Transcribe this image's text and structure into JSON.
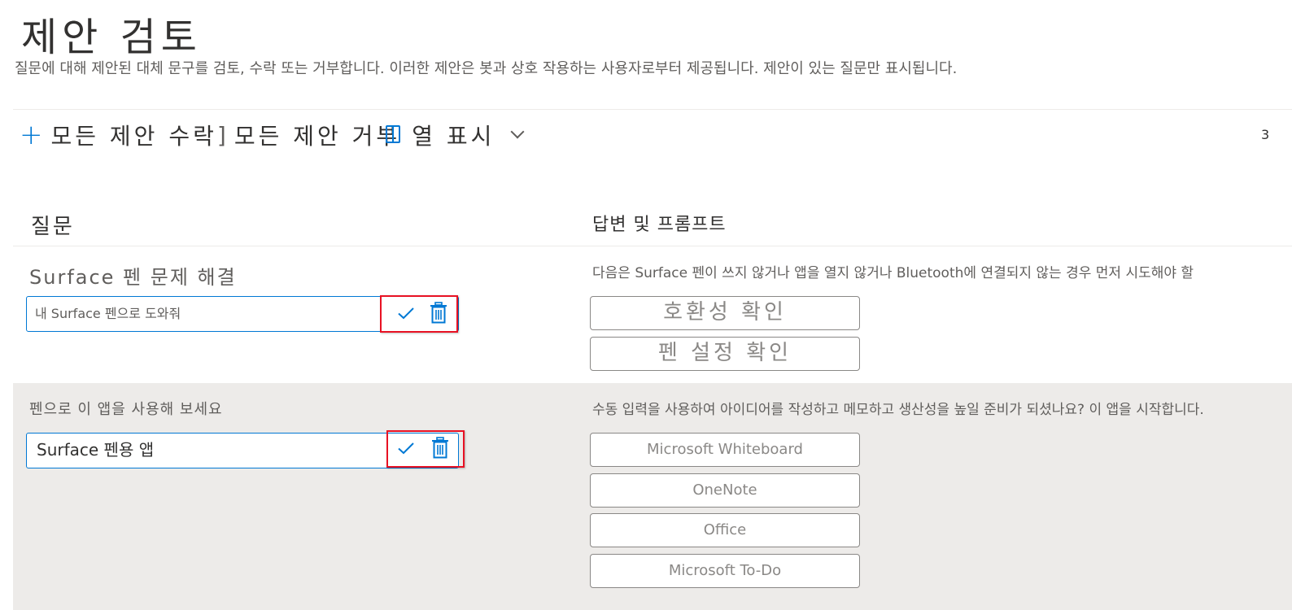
{
  "page": {
    "title": "제안 검토",
    "description": "질문에 대해 제안된 대체 문구를 검토, 수락 또는 거부합니다. 이러한 제안은 봇과 상호 작용하는 사용자로부터 제공됩니다. 제안이 있는 질문만 표시됩니다."
  },
  "toolbar": {
    "accept_all_label": "모든 제안 수락",
    "reject_all_label": "모든 제안 거부",
    "show_columns_label": "열 표시",
    "count_text": "3",
    "accent_color": "#0078d4"
  },
  "table": {
    "columns": {
      "question": "질문",
      "answer": "답변 및 프롬프트"
    },
    "rows": [
      {
        "question": "Surface 펜 문제 해결",
        "suggestion": "내 Surface 펜으로 도와줘",
        "answer": "다음은 Surface 펜이 쓰지 않거나 앱을 열지 않거나 Bluetooth에 연결되지 않는 경우 먼저 시도해야 할",
        "prompts": [
          "호환성 확인",
          "펜 설정 확인"
        ]
      },
      {
        "question": "펜으로 이 앱을 사용해 보세요",
        "suggestion": "Surface 펜용 앱",
        "answer": "수동 입력을 사용하여 아이디어를 작성하고 메모하고 생산성을 높일 준비가 되셨나요? 이 앱을 시작합니다.",
        "prompts": [
          "Microsoft Whiteboard",
          "OneNote",
          "Office",
          "Microsoft To-Do"
        ]
      }
    ]
  },
  "icons": {
    "accept": "check-icon",
    "reject": "trash-icon",
    "add": "plus-icon",
    "columns": "columns-icon",
    "dropdown": "chevron-down-icon"
  },
  "highlight_color": "#e81123",
  "selected_row_color": "#edebe9"
}
